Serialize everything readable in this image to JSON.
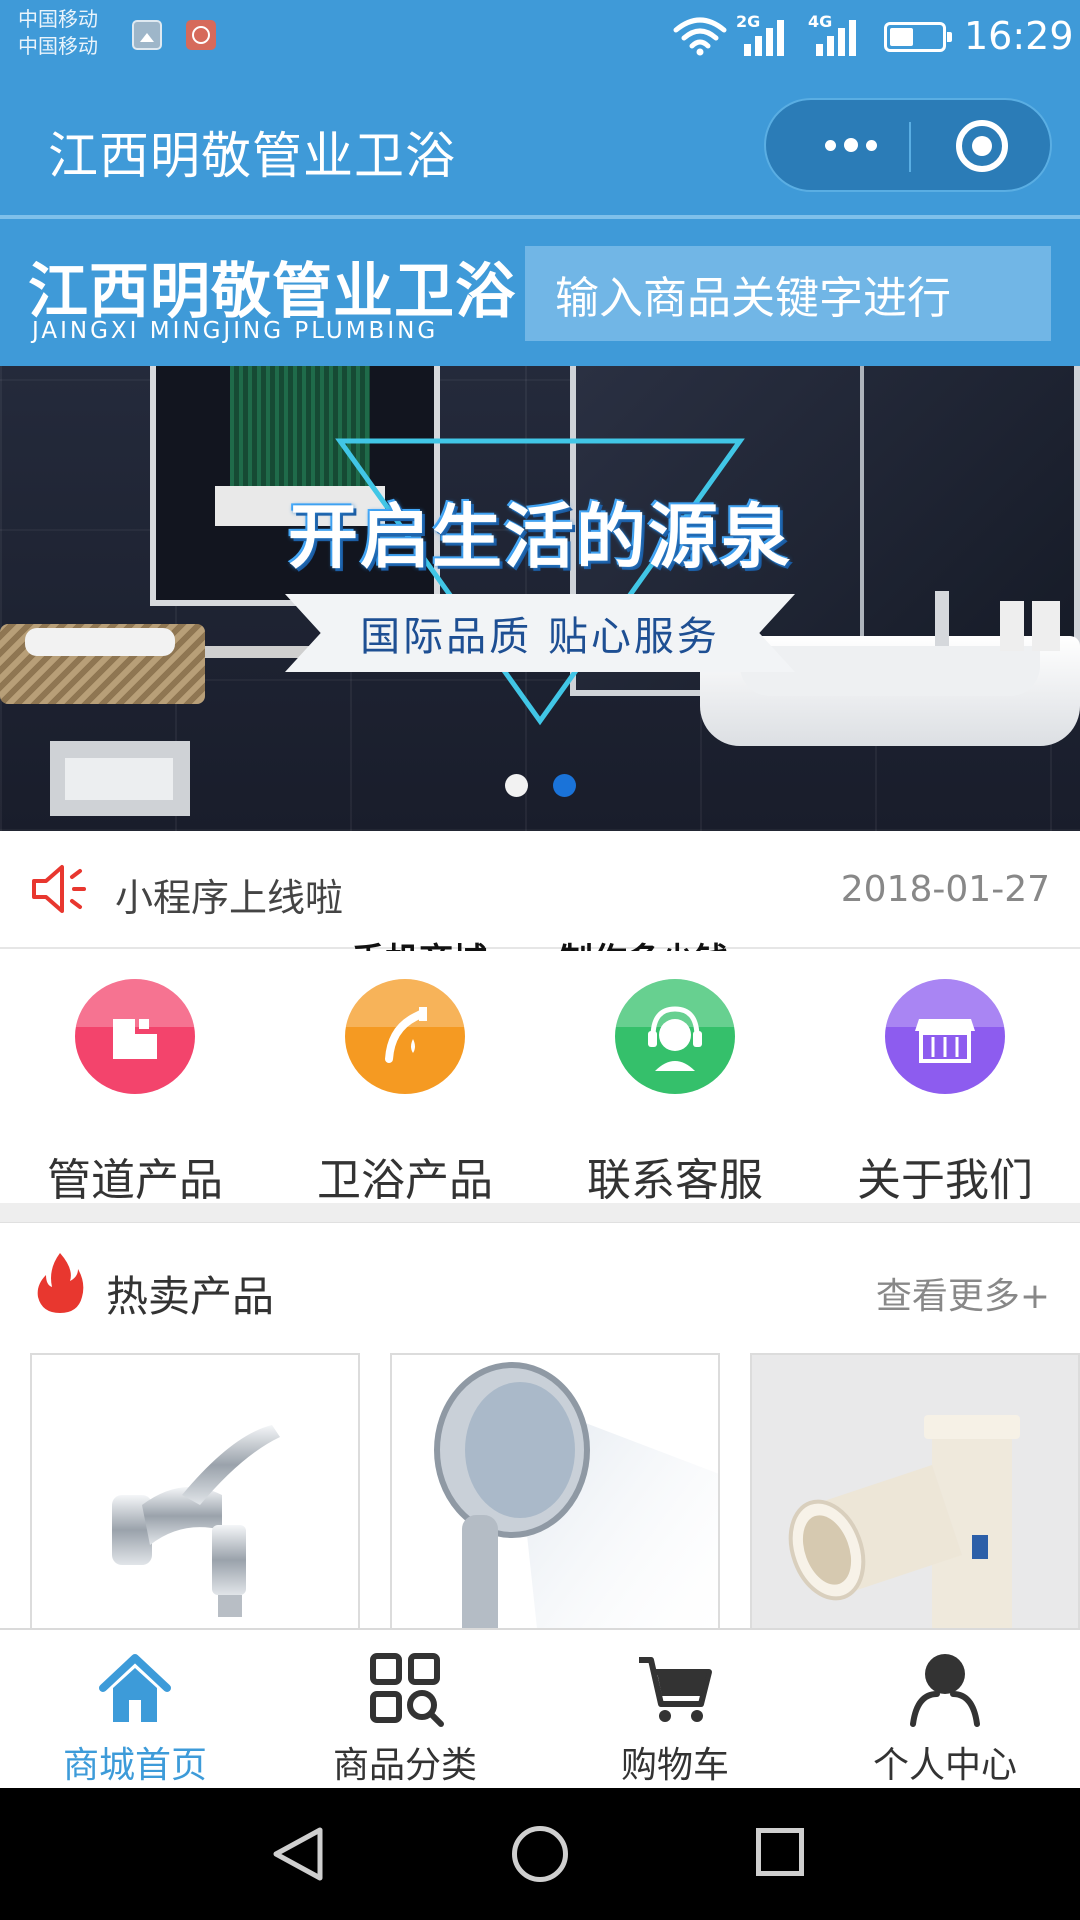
{
  "status_bar": {
    "carrier_1": "中国移动",
    "carrier_2": "中国移动",
    "network_1": "2G",
    "network_2": "4G",
    "battery_level": 0.45,
    "time": "16:29",
    "icons": [
      "gallery-icon",
      "app-notification-icon",
      "wifi-icon",
      "signal-2g-icon",
      "signal-4g-icon",
      "battery-icon"
    ]
  },
  "nav_bar": {
    "title": "江西明敬管业卫浴",
    "more_icon": "more-dots-icon",
    "close_icon": "target-close-icon"
  },
  "header": {
    "logo_cn": "江西明敬管业卫浴",
    "logo_en": "JAINGXI MINGJING PLUMBING",
    "search_placeholder": "输入商品关键字进行"
  },
  "banner": {
    "slogan": "开启生活的源泉",
    "subslogan": "国际品质 贴心服务",
    "slide_count": 2,
    "active_slide": 2
  },
  "notice": {
    "icon": "speaker-icon",
    "text": "小程序上线啦",
    "date": "2018-01-27"
  },
  "watermark": "手机商城app制作多少钱",
  "categories": [
    {
      "label": "管道产品",
      "icon": "pipe-icon",
      "color": "#f3446c"
    },
    {
      "label": "卫浴产品",
      "icon": "faucet-icon",
      "color": "#f59a22"
    },
    {
      "label": "联系客服",
      "icon": "customer-service-icon",
      "color": "#35c06b"
    },
    {
      "label": "关于我们",
      "icon": "store-icon",
      "color": "#8d5cef"
    }
  ],
  "hot": {
    "icon": "fire-icon",
    "title": "热卖产品",
    "more": "查看更多+",
    "products": [
      {
        "image": "faucet-tap-image"
      },
      {
        "image": "shower-head-image"
      },
      {
        "image": "pvc-pipe-fitting-image"
      }
    ]
  },
  "tab_bar": {
    "active": 0,
    "items": [
      {
        "label": "商城首页",
        "icon": "home-icon"
      },
      {
        "label": "商品分类",
        "icon": "category-grid-icon"
      },
      {
        "label": "购物车",
        "icon": "cart-icon"
      },
      {
        "label": "个人中心",
        "icon": "user-icon"
      }
    ]
  },
  "colors": {
    "brand_blue": "#3f9ad8",
    "tab_active": "#3d9bd9",
    "banner_dot_active": "#1a73d9",
    "fire_red": "#e8372f"
  }
}
